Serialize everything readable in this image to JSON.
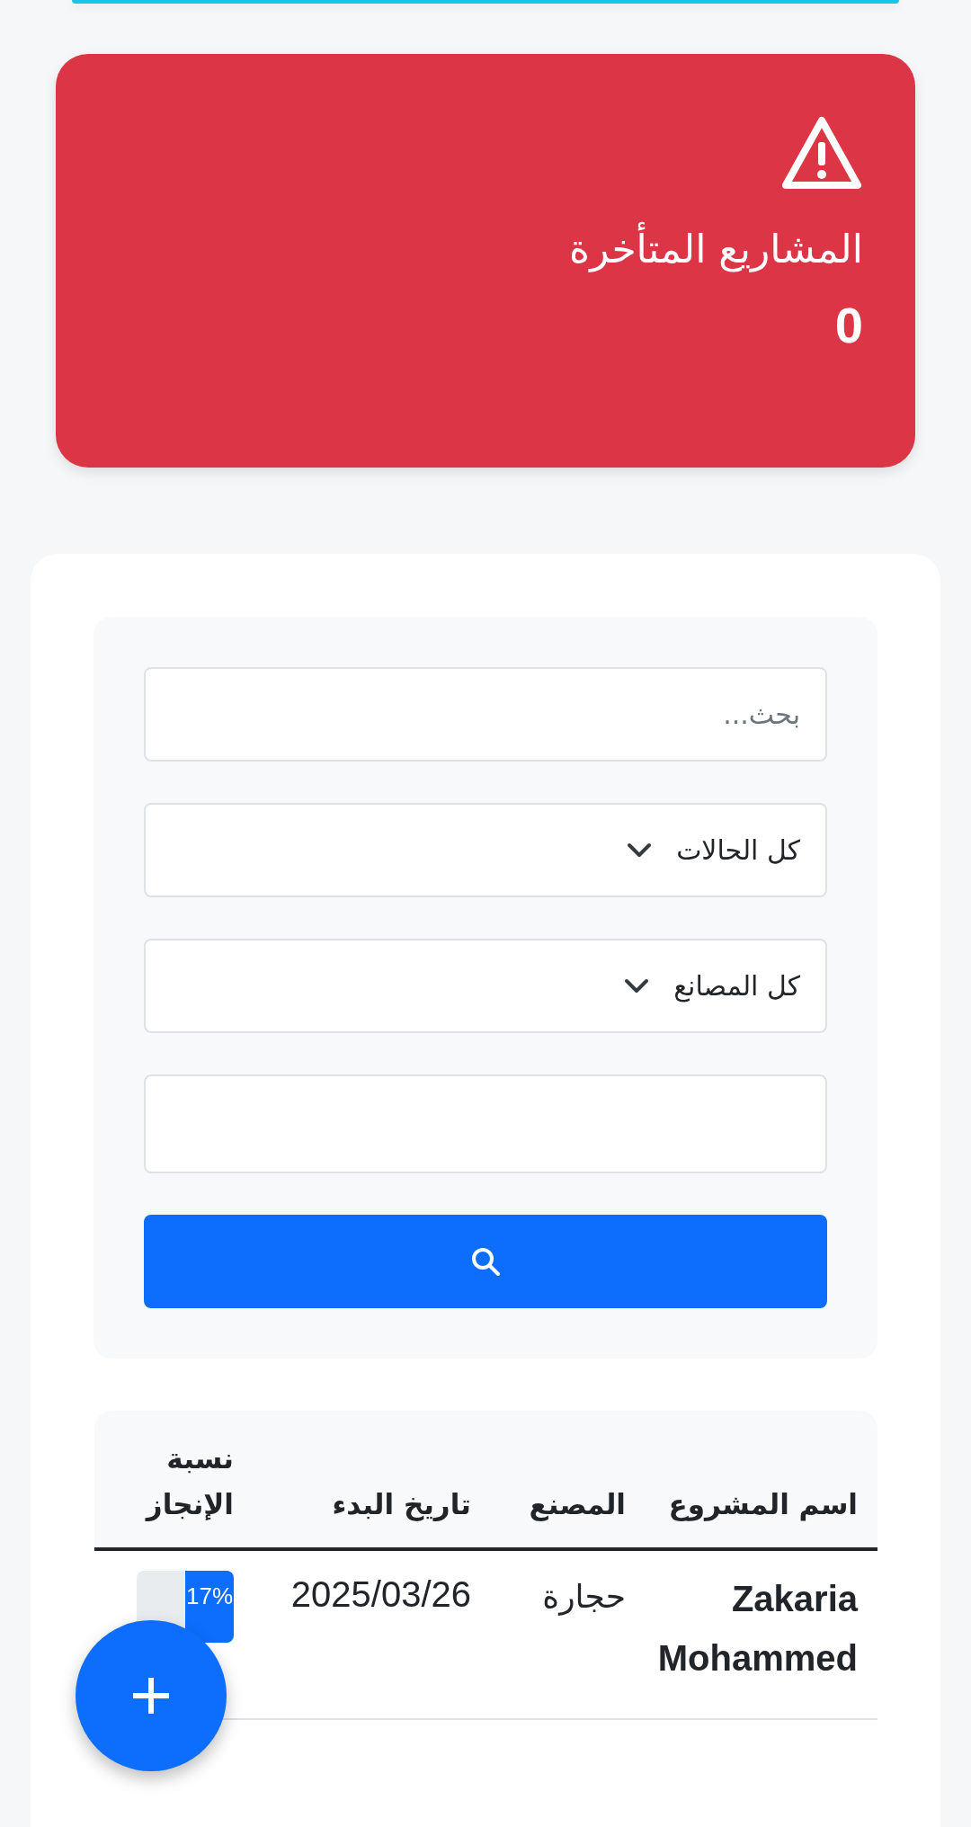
{
  "alert_card": {
    "title": "المشاريع المتأخرة",
    "count": "0"
  },
  "filters": {
    "search": {
      "placeholder": "بحث..."
    },
    "selects": [
      {
        "value": "كل الحالات"
      },
      {
        "value": "كل المصانع"
      }
    ]
  },
  "table": {
    "columns": [
      "اسم المشروع",
      "المصنع",
      "تاريخ البدء",
      "نسبة الإنجاز"
    ],
    "rows": [
      {
        "project": "Zakaria Mohammed",
        "factory": "حجارة",
        "start_date": "2025/03/26",
        "progress": {
          "level": 0.5,
          "label": "17%"
        }
      }
    ]
  }
}
